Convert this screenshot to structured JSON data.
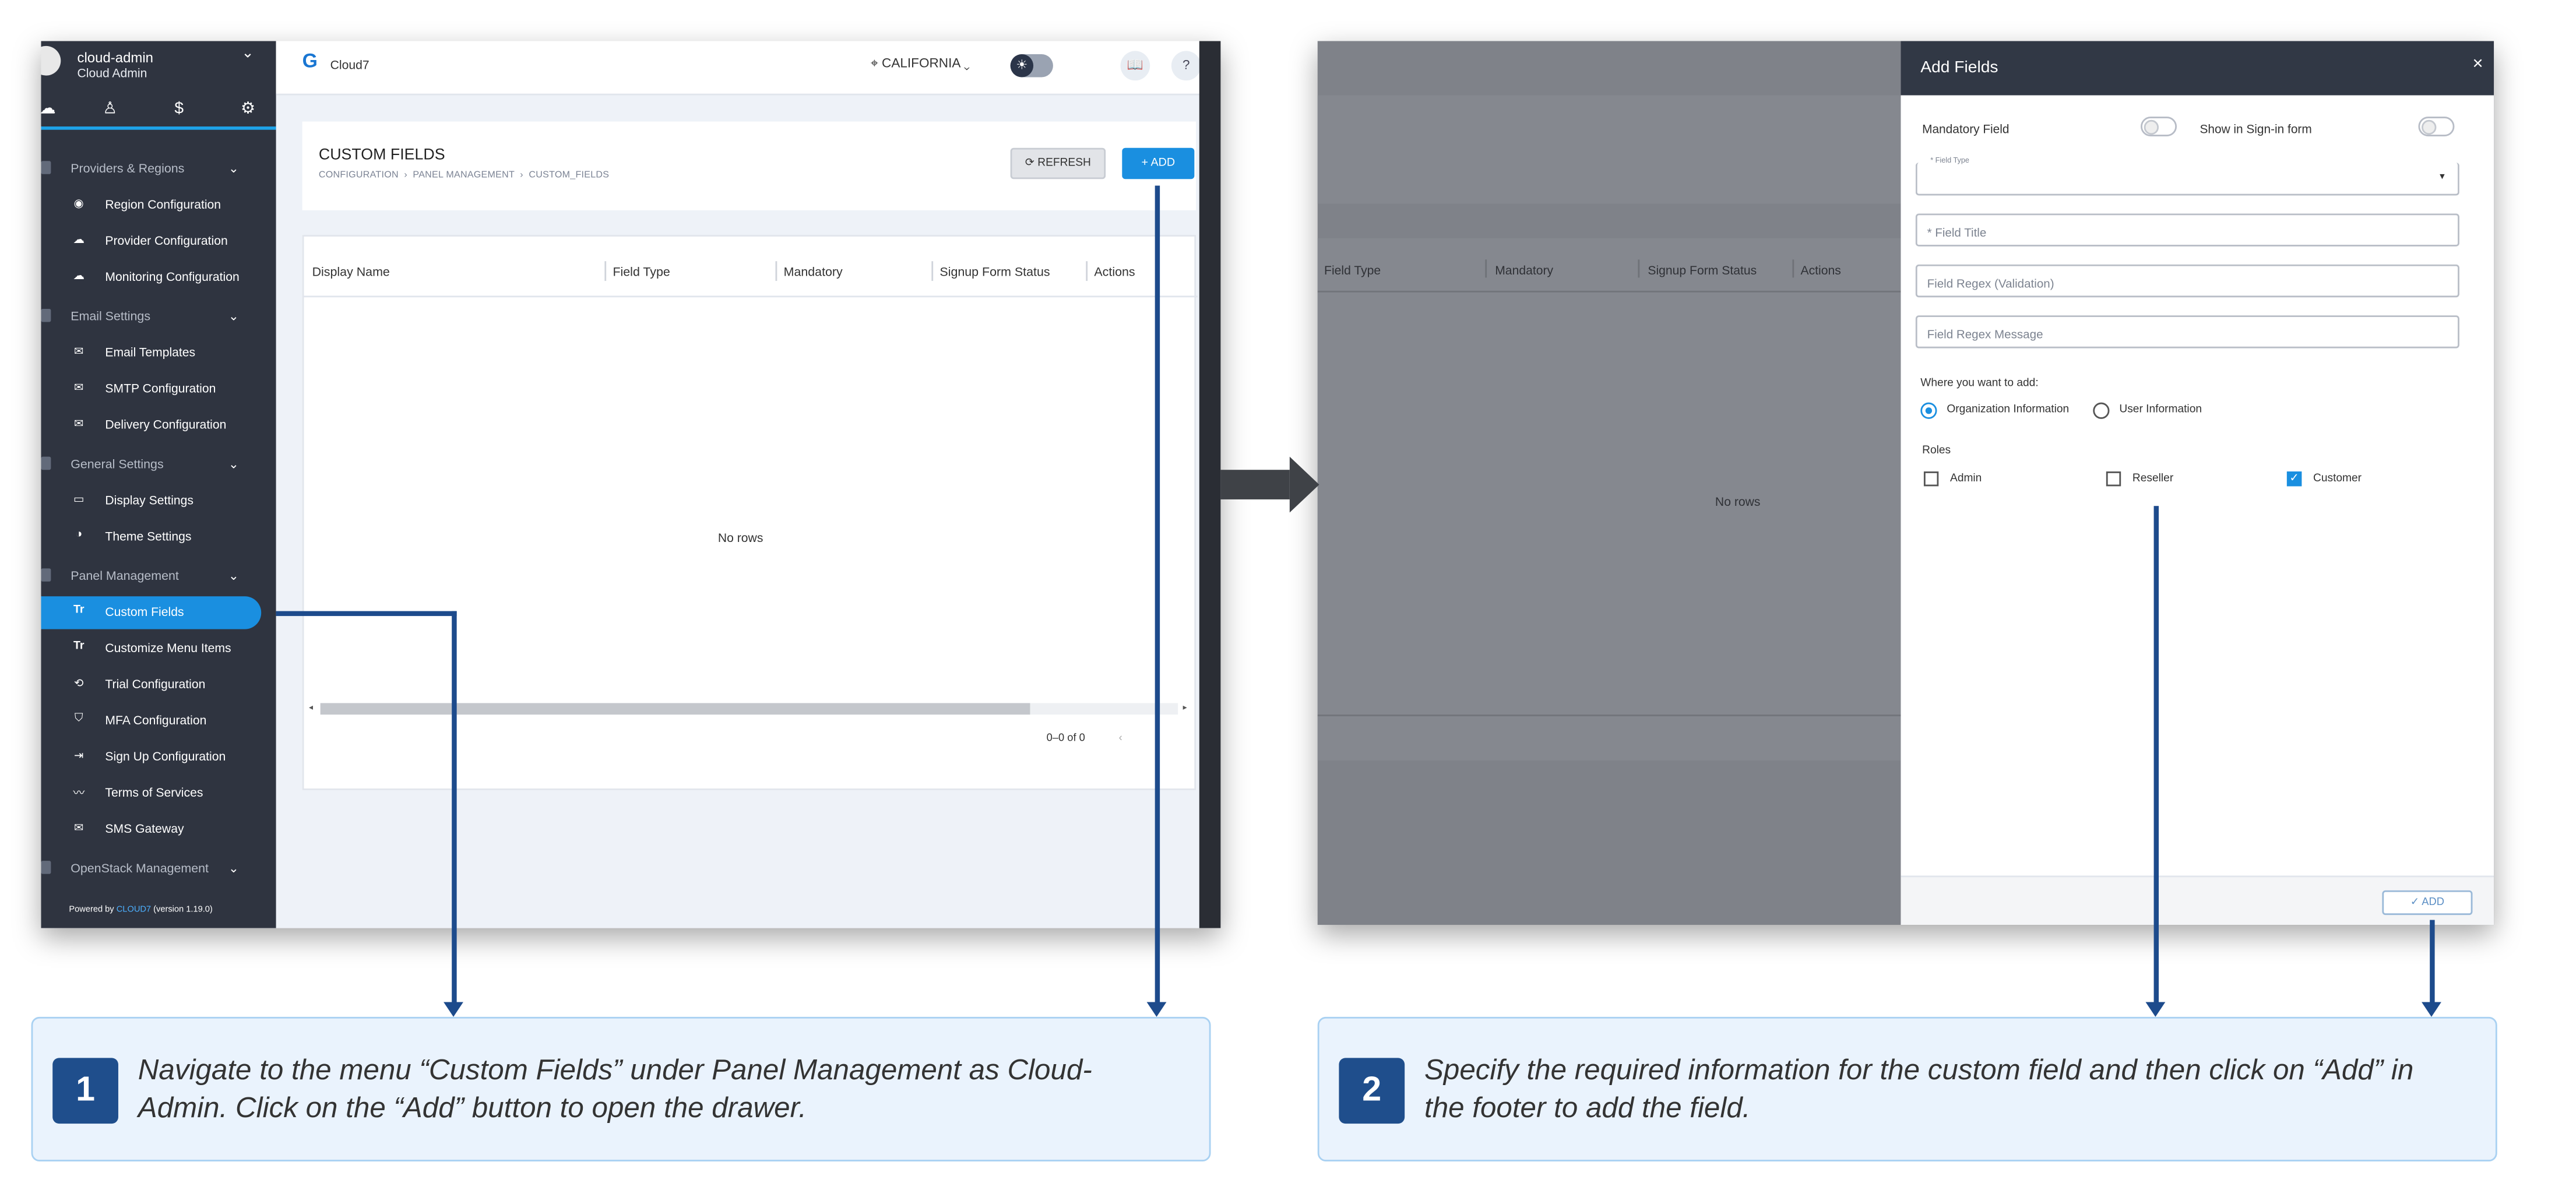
{
  "panel1": {
    "user": {
      "name": "cloud-admin",
      "role": "Cloud Admin"
    },
    "sidebar_tabs": [
      "cloud-icon",
      "user-icon",
      "dollar-icon",
      "gear-icon"
    ],
    "sidebar": {
      "groups": [
        {
          "label": "Providers & Regions",
          "items": [
            "Region Configuration",
            "Provider Configuration",
            "Monitoring Configuration"
          ]
        },
        {
          "label": "Email Settings",
          "items": [
            "Email Templates",
            "SMTP Configuration",
            "Delivery Configuration"
          ]
        },
        {
          "label": "General Settings",
          "items": [
            "Display Settings",
            "Theme Settings"
          ]
        },
        {
          "label": "Panel Management",
          "items": [
            "Custom Fields",
            "Customize Menu Items",
            "Trial Configuration",
            "MFA Configuration",
            "Sign Up Configuration",
            "Terms of Services",
            "SMS Gateway"
          ]
        },
        {
          "label": "OpenStack Management",
          "items": []
        }
      ],
      "active_item": "Custom Fields",
      "footer": {
        "prefix": "Powered by",
        "brand": "CLOUD7",
        "version": "(version 1.19.0)"
      }
    },
    "topbar": {
      "logo_text": "Cloud7",
      "region": "CALIFORNIA"
    },
    "page": {
      "title": "CUSTOM FIELDS",
      "breadcrumb": [
        "CONFIGURATION",
        "PANEL MANAGEMENT",
        "CUSTOM_FIELDS"
      ],
      "refresh_label": "REFRESH",
      "add_label": "ADD"
    },
    "grid": {
      "columns": [
        "Display Name",
        "Field Type",
        "Mandatory",
        "Signup Form Status",
        "Actions"
      ],
      "empty_text": "No rows",
      "pagination": "0–0 of 0"
    }
  },
  "panel2": {
    "background_grid": {
      "columns": [
        "Field Type",
        "Mandatory",
        "Signup Form Status",
        "Actions"
      ],
      "empty_text": "No rows"
    },
    "drawer": {
      "title": "Add Fields",
      "mandatory_label": "Mandatory Field",
      "signin_label": "Show in Sign-in form",
      "field_type_label": "* Field Type",
      "field_title_placeholder": "* Field Title",
      "regex_placeholder": "Field Regex (Validation)",
      "regex_message_placeholder": "Field Regex Message",
      "where_label": "Where you want to add:",
      "where_options": [
        {
          "label": "Organization Information",
          "selected": true
        },
        {
          "label": "User Information",
          "selected": false
        }
      ],
      "roles_label": "Roles",
      "roles": [
        {
          "label": "Admin",
          "checked": false
        },
        {
          "label": "Reseller",
          "checked": false
        },
        {
          "label": "Customer",
          "checked": true
        }
      ],
      "add_button": "ADD"
    }
  },
  "callouts": [
    {
      "number": "1",
      "line1": "Navigate to the menu “Custom Fields” under Panel Management as Cloud-",
      "line2": "Admin. Click on the “Add” button to open the drawer."
    },
    {
      "number": "2",
      "line1": "Specify the required information for the custom field and then click on “Add” in",
      "line2": "the footer to add the field."
    }
  ],
  "colors": {
    "accent": "#1a8fe0",
    "sidebar": "#2f3440",
    "callout_bg": "#eaf3fd",
    "arrow": "#1d4b8c"
  }
}
